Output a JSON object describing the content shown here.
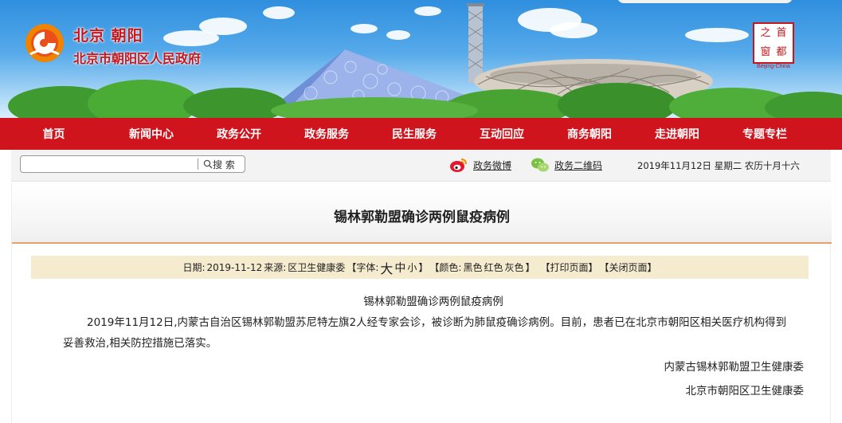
{
  "header": {
    "site_name": "北京 朝阳",
    "gov_name": "北京市朝阳区人民政府",
    "seal_chars": [
      "首",
      "都",
      "之",
      "窗"
    ],
    "seal_caption": "Beijing-China"
  },
  "nav": {
    "items": [
      "首页",
      "新闻中心",
      "政务公开",
      "政务服务",
      "民生服务",
      "互动回应",
      "商务朝阳",
      "走进朝阳",
      "专题专栏"
    ]
  },
  "toolbar": {
    "search_placeholder": "",
    "search_button": "搜 索",
    "weibo": "政务微博",
    "wechat": "政务二维码",
    "date": "2019年11月12日 星期二 农历十月十六"
  },
  "article": {
    "title": "锡林郭勒盟确诊两例鼠疫病例",
    "meta": {
      "date_label": "日期:",
      "date": "2019-11-12",
      "source_label": "来源:",
      "source": "区卫生健康委",
      "font_label": "【字体:",
      "font_large": "大",
      "font_medium": "中",
      "font_small": "小",
      "font_end": "】",
      "color_label": "【颜色:",
      "color_black": "黑色",
      "color_red": "红色",
      "color_gray": "灰色",
      "color_end": "】",
      "print": "【打印页面】",
      "close": "【关闭页面】"
    },
    "content_title": "锡林郭勒盟确诊两例鼠疫病例",
    "paragraph_line1": "2019年11月12日,内蒙古自治区锡林郭勒盟苏尼特左旗2人经专家会诊，被诊断为肺鼠疫确诊病例。目前，患者已在北京市朝阳区相关医疗机构得到",
    "paragraph_line2": "妥善救治,相关防控措施已落实。",
    "signature1": "内蒙古锡林郭勒盟卫生健康委",
    "signature2": "北京市朝阳区卫生健康委"
  },
  "colors": {
    "nav_red": "#d0141d",
    "brand_red": "#c4161c",
    "meta_bg": "#f5ebcf",
    "title_rule": "#e3a36c"
  },
  "icons": [
    "logo-icon",
    "search-icon",
    "weibo-icon",
    "wechat-icon",
    "seal-icon"
  ]
}
